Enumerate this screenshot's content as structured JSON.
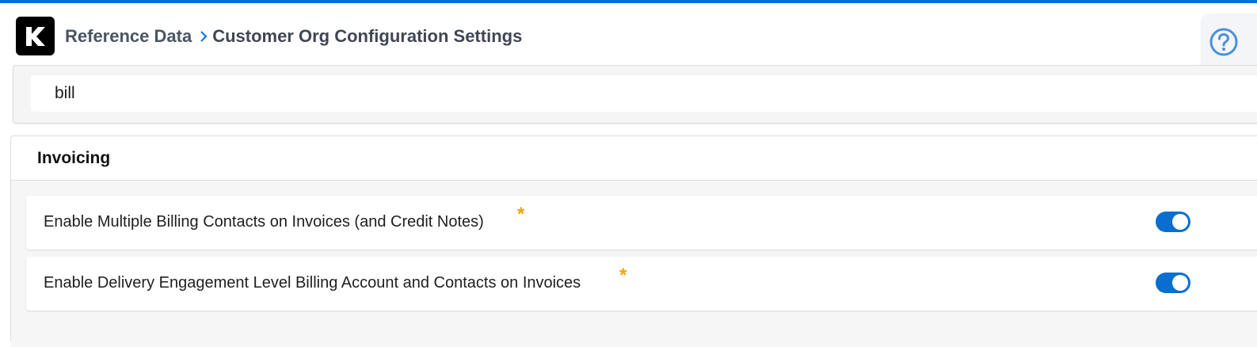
{
  "header": {
    "logo_letter": "K",
    "breadcrumb_parent": "Reference Data",
    "breadcrumb_current": "Customer Org Configuration Settings"
  },
  "search": {
    "value": "bill"
  },
  "section": {
    "title": "Invoicing",
    "settings": [
      {
        "label": "Enable Multiple Billing Contacts on Invoices (and Credit Notes)",
        "required_marker": "*",
        "enabled": true
      },
      {
        "label": "Enable Delivery Engagement Level Billing Account and Contacts on Invoices",
        "required_marker": "*",
        "enabled": true
      }
    ]
  },
  "colors": {
    "accent": "#0a6ed1",
    "required": "#f0a500"
  },
  "icons": {
    "help": "help-icon",
    "chevron": "chevron-right-icon"
  }
}
